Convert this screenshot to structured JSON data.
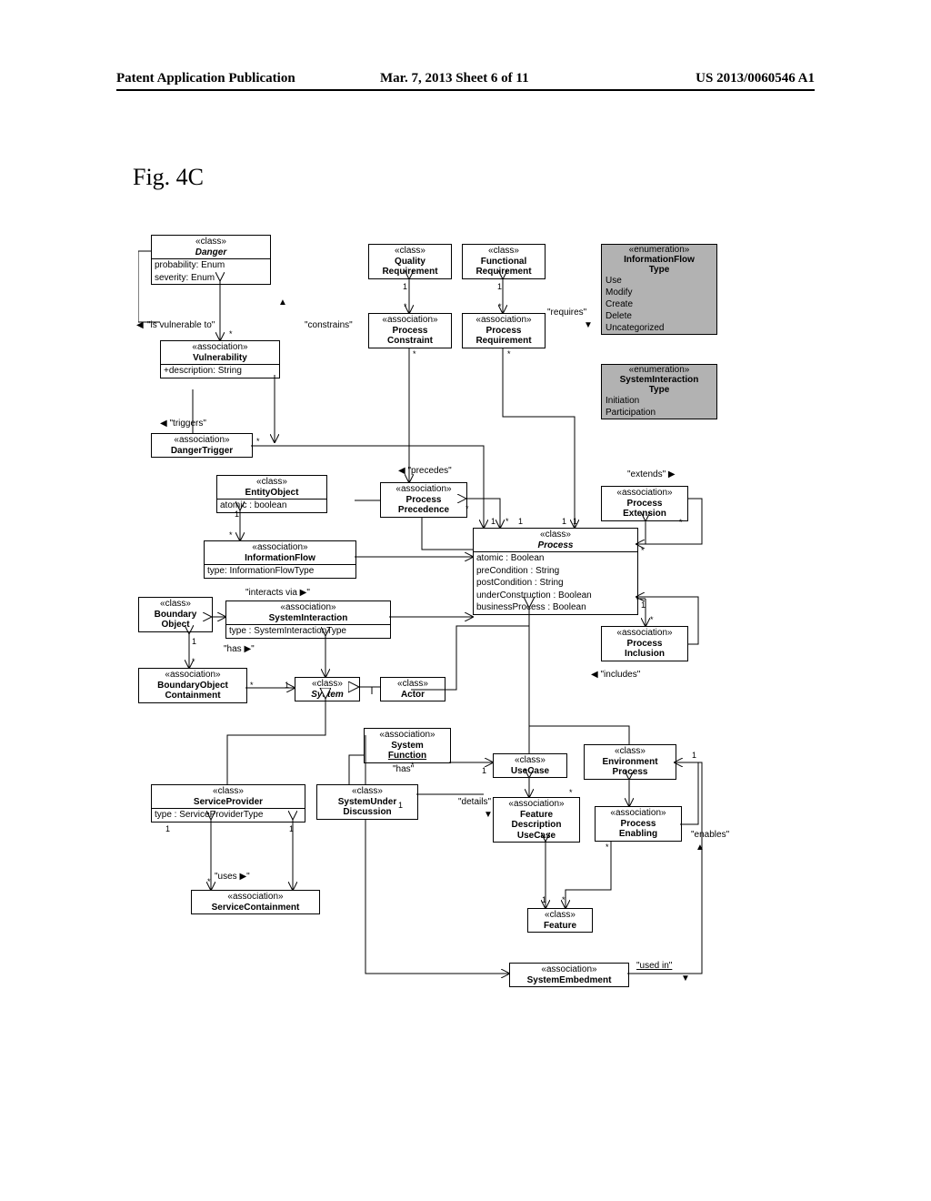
{
  "header": {
    "left": "Patent Application Publication",
    "mid": "Mar. 7, 2013  Sheet 6 of 11",
    "right": "US 2013/0060546 A1"
  },
  "figure_label": "Fig. 4C",
  "classes": {
    "danger": {
      "stereo": "«class»",
      "name": "Danger",
      "attr1": "probability: Enum",
      "attr2": "severity: Enum"
    },
    "qualityReq": {
      "stereo": "«class»",
      "name": "Quality",
      "name2": "Requirement"
    },
    "funcReq": {
      "stereo": "«class»",
      "name": "Functional",
      "name2": "Requirement"
    },
    "vuln": {
      "stereo": "«association»",
      "name": "Vulnerability",
      "attr1": "+description: String"
    },
    "procConst": {
      "stereo": "«association»",
      "name": "Process",
      "name2": "Constraint"
    },
    "procReq": {
      "stereo": "«association»",
      "name": "Process",
      "name2": "Requirement"
    },
    "dangerTrig": {
      "stereo": "«association»",
      "name": "DangerTrigger"
    },
    "entityObj": {
      "stereo": "«class»",
      "name": "EntityObject",
      "attr1": "atomic : boolean"
    },
    "procPrec": {
      "stereo": "«association»",
      "name": "Process",
      "name2": "Precedence"
    },
    "procExt": {
      "stereo": "«association»",
      "name": "Process",
      "name2": "Extension"
    },
    "infoFlow": {
      "stereo": "«association»",
      "name": "InformationFlow",
      "attr1": "type: InformationFlowType"
    },
    "process": {
      "stereo": "«class»",
      "name": "Process",
      "attr1": "atomic : Boolean",
      "attr2": "preCondition : String",
      "attr3": "postCondition : String",
      "attr4": "underConstruction : Boolean",
      "attr5": "businessProcess : Boolean"
    },
    "boundaryObj": {
      "stereo": "«class»",
      "name": "Boundary",
      "name2": "Object"
    },
    "sysInter": {
      "stereo": "«association»",
      "name": "SystemInteraction",
      "attr1": "type : SystemInteractionType"
    },
    "procIncl": {
      "stereo": "«association»",
      "name": "Process",
      "name2": "Inclusion"
    },
    "boundContain": {
      "stereo": "«association»",
      "name": "BoundaryObject",
      "name2": "Containment"
    },
    "system": {
      "stereo": "«class»",
      "name": "System"
    },
    "actor": {
      "stereo": "«class»",
      "name": "Actor"
    },
    "sysFunc": {
      "stereo": "«association»",
      "name": "System",
      "name2": "Function"
    },
    "useCase": {
      "stereo": "«class»",
      "name": "UseCase"
    },
    "envProc": {
      "stereo": "«class»",
      "name": "Environment",
      "name2": "Process"
    },
    "svcProv": {
      "stereo": "«class»",
      "name": "ServiceProvider",
      "attr1": "type : ServiceProviderType"
    },
    "sud": {
      "stereo": "«class»",
      "name": "SystemUnder",
      "name2": "Discussion"
    },
    "featDesc": {
      "stereo": "«association»",
      "name": "Feature",
      "name2": "Description",
      "name3": "UseCase"
    },
    "procEnab": {
      "stereo": "«association»",
      "name": "Process",
      "name2": "Enabling"
    },
    "svcContain": {
      "stereo": "«association»",
      "name": "ServiceContainment"
    },
    "feature": {
      "stereo": "«class»",
      "name": "Feature"
    },
    "sysEmbed": {
      "stereo": "«association»",
      "name": "SystemEmbedment"
    }
  },
  "enums": {
    "infoFlowType": {
      "stereo": "«enumeration»",
      "name": "InformationFlow",
      "name2": "Type",
      "v1": "Use",
      "v2": "Modify",
      "v3": "Create",
      "v4": "Delete",
      "v5": "Uncategorized"
    },
    "sysInterType": {
      "stereo": "«enumeration»",
      "name": "SystemInteraction",
      "name2": "Type",
      "v1": "Initiation",
      "v2": "Participation"
    }
  },
  "labels": {
    "isVulnerable": "\"is vulnerable to\"",
    "constrains": "\"constrains\"",
    "requires": "\"requires\"",
    "triggers": "\"triggers\"",
    "precedes": "\"precedes\"",
    "extends": "\"extends\"",
    "interactsVia": "\"interacts via ▶\"",
    "has": "\"has ▶\"",
    "has2": "\"has\"",
    "details": "\"details\"",
    "includes": "\"includes\"",
    "enables": "\"enables\"",
    "uses": "\"uses ▶\"",
    "usedIn": "\"used in\"",
    "arrowLeft": "◀",
    "arrowRight": "▶",
    "arrowUp": "▲",
    "arrowDown": "▼"
  },
  "mult": {
    "one": "1",
    "star": "*"
  }
}
